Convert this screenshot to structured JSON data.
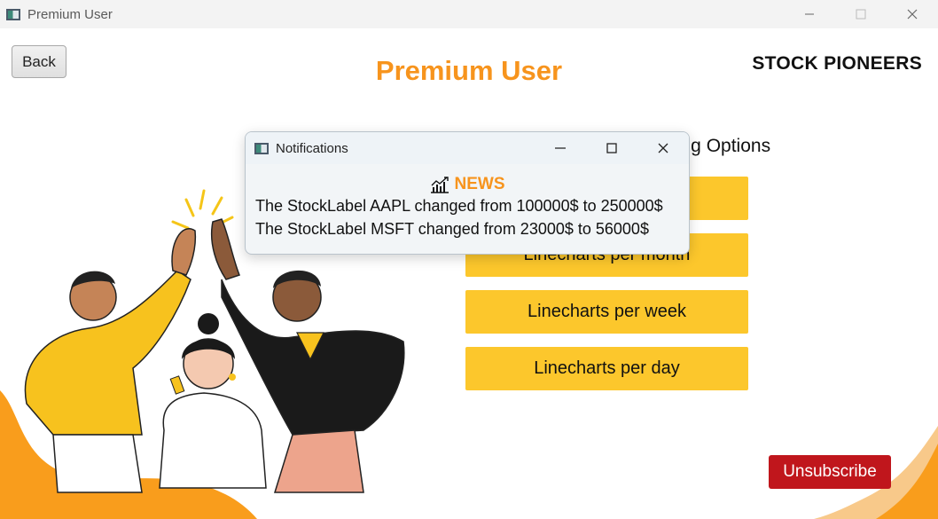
{
  "window": {
    "title": "Premium User",
    "icon": "app-window-icon"
  },
  "header": {
    "back_label": "Back",
    "page_title": "Premium User",
    "brand": "STOCK PIONEERS"
  },
  "options": {
    "title": "ting Options",
    "buttons": [
      {
        "label": ""
      },
      {
        "label": "Linecharts per month"
      },
      {
        "label": "Linecharts per week"
      },
      {
        "label": "Linecharts per day"
      }
    ]
  },
  "unsubscribe_label": "Unsubscribe",
  "notifications": {
    "title": "Notifications",
    "news_label": "NEWS",
    "news_icon": "chart-icon",
    "lines": [
      "The StockLabel AAPL changed from 100000$ to 250000$",
      "The StockLabel MSFT changed from 23000$ to 56000$"
    ]
  },
  "colors": {
    "accent": "#f7941d",
    "button": "#fcc72c",
    "danger": "#c0161c"
  }
}
